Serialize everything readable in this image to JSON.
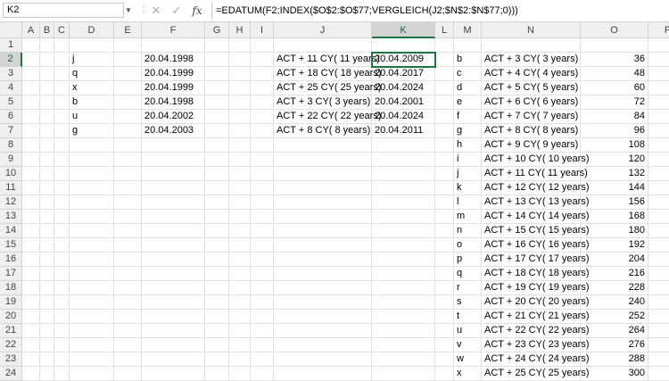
{
  "name_box": "K2",
  "formula_bar": {
    "cancel_icon": "✕",
    "enter_icon": "✓",
    "fx_label": "fx",
    "formula": "=EDATUM(F2;INDEX($O$2:$O$77;VERGLEICH(J2;$N$2:$N$77;0)))"
  },
  "columns": [
    "A",
    "B",
    "C",
    "D",
    "E",
    "F",
    "G",
    "H",
    "I",
    "J",
    "K",
    "L",
    "M",
    "N",
    "O",
    "P"
  ],
  "selected_column": "K",
  "rows": [
    "1",
    "2",
    "3",
    "4",
    "5",
    "6",
    "7",
    "8",
    "9",
    "10",
    "11",
    "12",
    "13",
    "14",
    "15",
    "16",
    "17",
    "18",
    "19",
    "20",
    "21",
    "22",
    "23",
    "24"
  ],
  "selected_row": "2",
  "data_rows": [
    {
      "D": "",
      "F": "",
      "J": "",
      "K": "",
      "M": "",
      "N": "",
      "O": ""
    },
    {
      "D": "j",
      "F": "20.04.1998",
      "J": "ACT + 11 CY( 11 years)",
      "K": "20.04.2009",
      "M": "b",
      "N": "ACT + 3 CY( 3 years)",
      "O": "36"
    },
    {
      "D": "q",
      "F": "20.04.1999",
      "J": "ACT + 18 CY( 18 years)",
      "K": "20.04.2017",
      "M": "c",
      "N": "ACT + 4 CY( 4 years)",
      "O": "48"
    },
    {
      "D": "x",
      "F": "20.04.1999",
      "J": "ACT + 25 CY( 25 years)",
      "K": "20.04.2024",
      "M": "d",
      "N": "ACT + 5 CY( 5 years)",
      "O": "60"
    },
    {
      "D": "b",
      "F": "20.04.1998",
      "J": "ACT + 3 CY( 3 years)",
      "K": "20.04.2001",
      "M": "e",
      "N": "ACT + 6 CY( 6 years)",
      "O": "72"
    },
    {
      "D": "u",
      "F": "20.04.2002",
      "J": "ACT + 22 CY( 22 years)",
      "K": "20.04.2024",
      "M": "f",
      "N": "ACT + 7 CY( 7 years)",
      "O": "84"
    },
    {
      "D": "g",
      "F": "20.04.2003",
      "J": "ACT + 8 CY( 8 years)",
      "K": "20.04.2011",
      "M": "g",
      "N": "ACT + 8 CY( 8 years)",
      "O": "96"
    },
    {
      "D": "",
      "F": "",
      "J": "",
      "K": "",
      "M": "h",
      "N": "ACT + 9 CY( 9 years)",
      "O": "108"
    },
    {
      "D": "",
      "F": "",
      "J": "",
      "K": "",
      "M": "i",
      "N": "ACT + 10 CY( 10 years)",
      "O": "120"
    },
    {
      "D": "",
      "F": "",
      "J": "",
      "K": "",
      "M": "j",
      "N": "ACT + 11 CY( 11 years)",
      "O": "132"
    },
    {
      "D": "",
      "F": "",
      "J": "",
      "K": "",
      "M": "k",
      "N": "ACT + 12 CY( 12 years)",
      "O": "144"
    },
    {
      "D": "",
      "F": "",
      "J": "",
      "K": "",
      "M": "l",
      "N": "ACT + 13 CY( 13 years)",
      "O": "156"
    },
    {
      "D": "",
      "F": "",
      "J": "",
      "K": "",
      "M": "m",
      "N": "ACT + 14 CY( 14 years)",
      "O": "168"
    },
    {
      "D": "",
      "F": "",
      "J": "",
      "K": "",
      "M": "n",
      "N": "ACT + 15 CY( 15 years)",
      "O": "180"
    },
    {
      "D": "",
      "F": "",
      "J": "",
      "K": "",
      "M": "o",
      "N": "ACT + 16 CY( 16 years)",
      "O": "192"
    },
    {
      "D": "",
      "F": "",
      "J": "",
      "K": "",
      "M": "p",
      "N": "ACT + 17 CY( 17 years)",
      "O": "204"
    },
    {
      "D": "",
      "F": "",
      "J": "",
      "K": "",
      "M": "q",
      "N": "ACT + 18 CY( 18 years)",
      "O": "216"
    },
    {
      "D": "",
      "F": "",
      "J": "",
      "K": "",
      "M": "r",
      "N": "ACT + 19 CY( 19 years)",
      "O": "228"
    },
    {
      "D": "",
      "F": "",
      "J": "",
      "K": "",
      "M": "s",
      "N": "ACT + 20 CY( 20 years)",
      "O": "240"
    },
    {
      "D": "",
      "F": "",
      "J": "",
      "K": "",
      "M": "t",
      "N": "ACT + 21 CY( 21 years)",
      "O": "252"
    },
    {
      "D": "",
      "F": "",
      "J": "",
      "K": "",
      "M": "u",
      "N": "ACT + 22 CY( 22 years)",
      "O": "264"
    },
    {
      "D": "",
      "F": "",
      "J": "",
      "K": "",
      "M": "v",
      "N": "ACT + 23 CY( 23 years)",
      "O": "276"
    },
    {
      "D": "",
      "F": "",
      "J": "",
      "K": "",
      "M": "w",
      "N": "ACT + 24 CY( 24 years)",
      "O": "288"
    },
    {
      "D": "",
      "F": "",
      "J": "",
      "K": "",
      "M": "x",
      "N": "ACT + 25 CY( 25 years)",
      "O": "300"
    }
  ]
}
